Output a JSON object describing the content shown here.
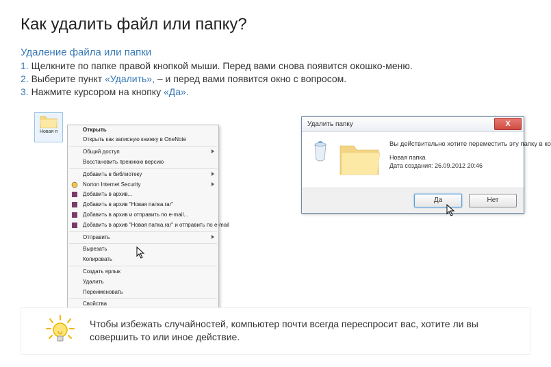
{
  "title": "Как удалить файл или папку?",
  "subtitle": "Удаление файла или папки",
  "steps": [
    {
      "num": "1.",
      "text_a": "Щелкните по папке правой кнопкой мыши. Перед вами снова появится окошко-меню."
    },
    {
      "num": "2.",
      "text_a": "Выберите пункт ",
      "hl": "«Удалить»,",
      "text_b": " – и перед вами появится окно с вопросом."
    },
    {
      "num": "3.",
      "text_a": "Нажмите курсором на кнопку ",
      "hl": "«Да».",
      "text_b": ""
    }
  ],
  "folder_label": "Новая п",
  "context_menu": {
    "open": "Открыть",
    "open_onenote": "Открыть как записную книжку в OneNote",
    "share": "Общий доступ",
    "restore": "Восстановить прежнюю версию",
    "library": "Добавить в библиотеку",
    "norton": "Norton Internet Security",
    "archive": "Добавить в архив...",
    "archive_new": "Добавить в архив \"Новая папка.rar\"",
    "archive_mail": "Добавить в архив и отправить по e-mail...",
    "archive_new_mail": "Добавить в архив \"Новая папка.rar\" и отправить по e-mail",
    "send": "Отправить",
    "cut": "Вырезать",
    "copy": "Копировать",
    "shortcut": "Создать ярлык",
    "delete": "Удалить",
    "rename": "Переименовать",
    "props": "Свойства"
  },
  "dialog": {
    "title": "Удалить папку",
    "question": "Вы действительно хотите переместить эту папку в корзину?",
    "name": "Новая папка",
    "date": "Дата создания: 26.09.2012 20:46",
    "yes": "Да",
    "no": "Нет"
  },
  "tip": "Чтобы избежать случайностей, компьютер почти всегда переспросит вас, хотите ли вы совершить то или иное действие."
}
